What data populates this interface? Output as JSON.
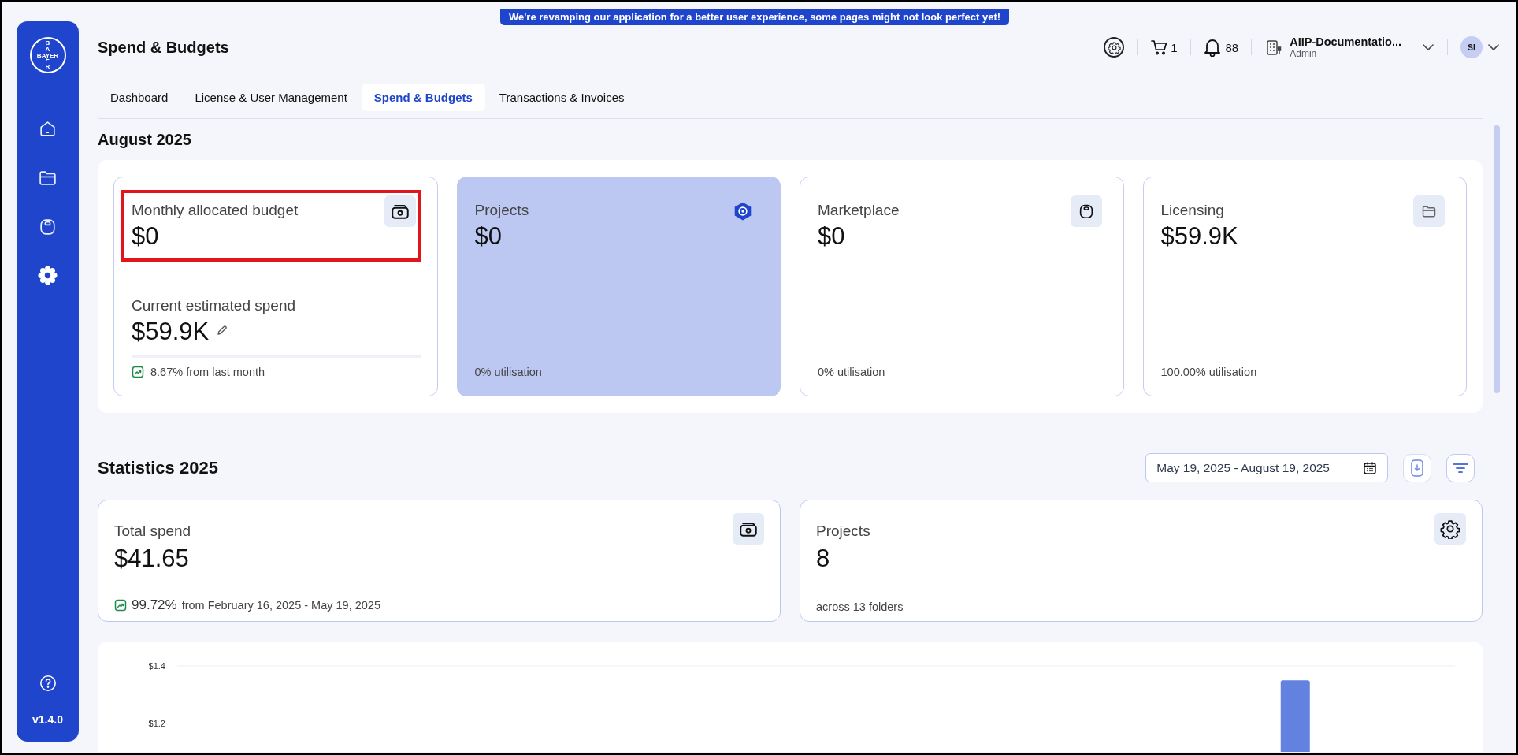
{
  "banner": "We're revamping our application for a better user experience, some pages might not look perfect yet!",
  "sidebar": {
    "logo": {
      "horizontal": "BAYER",
      "vertical_top": "BA",
      "vertical_bottom": "ER"
    },
    "items": [
      {
        "selected": false
      },
      {
        "selected": false
      },
      {
        "selected": false
      },
      {
        "selected": true
      }
    ],
    "version": "v1.4.0"
  },
  "header": {
    "title": "Spend & Budgets",
    "cart_count": "1",
    "notification_count": "88",
    "organization": "AIIP-Documentatio...",
    "role": "Admin",
    "avatar_initials": "SI"
  },
  "tabs": [
    {
      "label": "Dashboard",
      "selected": false
    },
    {
      "label": "License & User Management",
      "selected": false
    },
    {
      "label": "Spend & Budgets",
      "selected": true
    },
    {
      "label": "Transactions & Invoices",
      "selected": false
    }
  ],
  "budget": {
    "title": "August 2025",
    "cards": [
      {
        "kind": "budget",
        "label": "Monthly allocated budget",
        "value": "$0",
        "highlighted": true,
        "spend_label": "Current estimated spend",
        "spend_value": "$59.9K",
        "level": 0,
        "trend": "8.67% from last month"
      },
      {
        "kind": "category",
        "label": "Projects",
        "value": "$0",
        "selected": true,
        "utilisation": "0% utilisation"
      },
      {
        "kind": "category",
        "label": "Marketplace",
        "value": "$0",
        "selected": false,
        "utilisation": "0% utilisation"
      },
      {
        "kind": "category",
        "label": "Licensing",
        "value": "$59.9K",
        "selected": false,
        "utilisation": "100.00% utilisation"
      }
    ]
  },
  "statistics": {
    "title": "Statistics 2025",
    "date_range": "May 19, 2025 - August 19, 2025",
    "cards": [
      {
        "kind": "trend",
        "label": "Total spend",
        "value": "$41.65",
        "change": "99.72%",
        "change_note": "from February 16, 2025 - May 19, 2025"
      },
      {
        "kind": "note",
        "label": "Projects",
        "value": "8",
        "note": "across 13 folders"
      }
    ]
  },
  "chart": {
    "chart_data": {
      "type": "bar",
      "ylim": [
        1.1,
        1.4
      ],
      "yticks": [
        {
          "value": 1.2,
          "label": "$1.2"
        },
        {
          "value": 1.4,
          "label": "$1.4"
        }
      ],
      "values": [
        null,
        null,
        null,
        1.35
      ]
    }
  }
}
